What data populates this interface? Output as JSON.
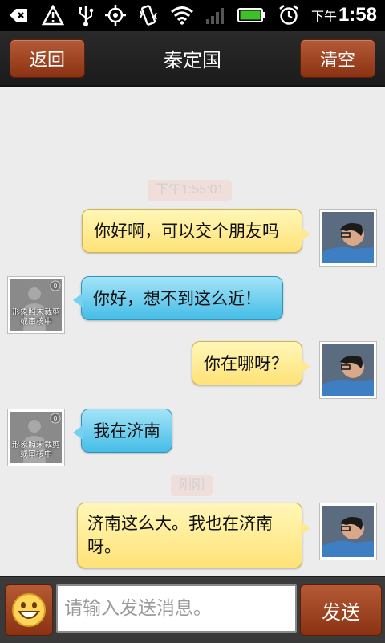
{
  "status_bar": {
    "ampm": "下午",
    "time": "1:58",
    "battery_color": "#3fbf2a"
  },
  "header": {
    "back_label": "返回",
    "title": "秦定国",
    "clear_label": "清空"
  },
  "messages": [
    {
      "type": "timestamp",
      "text": "下午1:55:01"
    },
    {
      "type": "message",
      "sender": "me",
      "text": "你好啊，可以交个朋友吗"
    },
    {
      "type": "message",
      "sender": "other",
      "text": "你好，想不到这么近！",
      "avatar_badge": "0",
      "avatar_caption": "形象照未裁剪或审核中"
    },
    {
      "type": "message",
      "sender": "me",
      "text": "你在哪呀？"
    },
    {
      "type": "message",
      "sender": "other",
      "text": "我在济南",
      "avatar_badge": "0",
      "avatar_caption": "形象照未裁剪或审核中"
    },
    {
      "type": "timestamp",
      "text": "刚刚"
    },
    {
      "type": "message",
      "sender": "me",
      "text": "济南这么大。我也在济南呀。"
    }
  ],
  "composer": {
    "placeholder": "请输入发送消息。",
    "send_label": "发送"
  },
  "colors": {
    "accent_button": "#9a4220",
    "bubble_me": "#ffe277",
    "bubble_other": "#45bde8"
  }
}
